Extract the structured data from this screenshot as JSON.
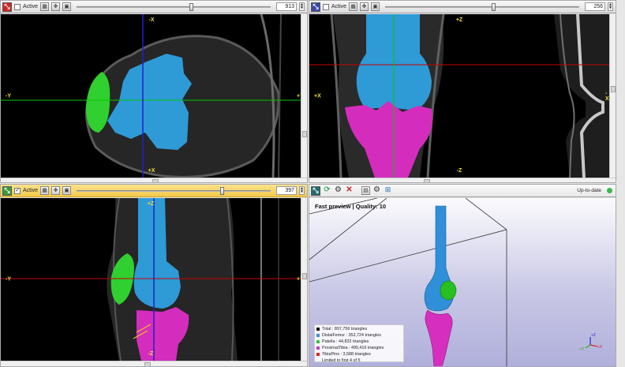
{
  "panes": {
    "axial": {
      "active_label": "Active",
      "slice_value": "913",
      "slider_fraction": 0.58,
      "axis_labels": {
        "top": "-X",
        "bottom": "+X",
        "left": "-Y",
        "right": "+Y"
      },
      "color": "#d42222"
    },
    "coronal": {
      "active_label": "Active",
      "slice_value": "256",
      "slider_fraction": 0.55,
      "axis_labels": {
        "top": "+Z",
        "bottom": "-Z",
        "left": "+X",
        "right": "-X"
      },
      "color": "#3a48a8"
    },
    "sagittal": {
      "active_label": "Active",
      "slice_value": "397",
      "slider_fraction": 0.74,
      "axis_labels": {
        "top": "+Z",
        "bottom": "-Z",
        "left": "-Y",
        "right": "+Y"
      },
      "color": "#3b9a3b"
    },
    "preview3d": {
      "title": "Fast preview | Quality: 10",
      "status": "Up-to-date",
      "status_color": "#3cb84a",
      "toolbar_icons": [
        "fit-icon",
        "refresh-icon",
        "settings-icon",
        "close-icon",
        "snapshot-icon",
        "render-settings-icon",
        "mesh-icon"
      ],
      "legend": [
        {
          "label": "Total : 897,756 triangles",
          "color": "#111111"
        },
        {
          "label": "DistalFemur : 352,724 triangles",
          "color": "#3d8fd6"
        },
        {
          "label": "Patella : 44,832 triangles",
          "color": "#36c23a"
        },
        {
          "label": "ProximalTibia : 495,416 triangles",
          "color": "#c73ac0"
        },
        {
          "label": "TibiaPins : 3,588 triangles",
          "color": "#cf2a2a"
        },
        {
          "label": "Limited to first 4 of 5",
          "color": ""
        }
      ],
      "orientation_axes": {
        "z": "+Z",
        "x": "+X",
        "y": "+Y"
      }
    }
  },
  "colors": {
    "femur": "#2e9ad6",
    "patella": "#2fd030",
    "tibia": "#d42dbd",
    "crosshair_green": "#00c800",
    "crosshair_blue": "#2020c8",
    "crosshair_red": "#c80000",
    "label_yellow": "#f0e042"
  }
}
